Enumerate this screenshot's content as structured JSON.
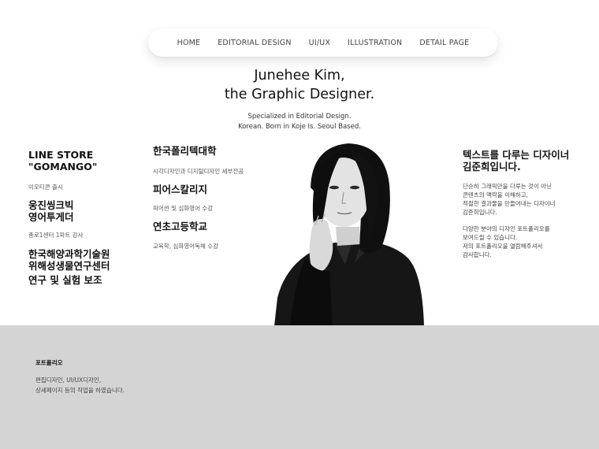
{
  "nav": {
    "items": [
      {
        "label": "HOME"
      },
      {
        "label": "EDITORIAL DESIGN"
      },
      {
        "label": "UI/UX"
      },
      {
        "label": "ILLUSTRATION"
      },
      {
        "label": "DETAIL PAGE"
      }
    ]
  },
  "hero": {
    "title_line1": "Junehee Kim,",
    "title_line2": "the Graphic Designer.",
    "sub_line1": "Specialized in Editorial Design.",
    "sub_line2": "Korean. Born in Koje Is. Seoul Based."
  },
  "left": {
    "title1_line1": "LINE STORE",
    "title1_line2": "\"GOMANGO\"",
    "note1": "이모티콘 출시",
    "title2_line1": "웅진씽크빅",
    "title2_line2": "영어투게더",
    "note2": "총로1센터 1파트 강사",
    "title3_line1": "한국해양과학기술원",
    "title3_line2": "위해성생물연구센터",
    "title3_line3": "연구 및 실험 보조"
  },
  "middle": {
    "title1": "한국폴리텍대학",
    "note1": "시각디자인과 디지털디자인 세부전공",
    "title2": "피어스칼리지",
    "note2": "피어썬 및 심화영어 수강",
    "title3": "연초고등학교",
    "note3": "교육학, 심화영어독해 수강"
  },
  "right": {
    "title_line1": "텍스트를 다루는 디자이너",
    "title_line2": "김준희입니다.",
    "p1_line1": "단순히 그래픽만을 다루는 것이 아닌",
    "p1_line2": "콘텐츠의 맥락을 이해하고,",
    "p1_line3": "적절한 결과물을 만들어내는 디자이너",
    "p1_line4": "김준희입니다.",
    "p2_line1": "다양한 분야의 디자인 포트폴리오를",
    "p2_line2": "보여드릴 수 있습니다.",
    "p2_line3": "저의 포트폴리오을 열람해주셔서",
    "p2_line4": "감사합니다."
  },
  "footer": {
    "title": "포트폴리오",
    "line1": "편집디자인, UI/UX디자인,",
    "line2": "상세페이지 등의 작업을 하였습니다."
  },
  "colors": {
    "footer_bg": "#d4d4d4",
    "text": "#111111"
  }
}
